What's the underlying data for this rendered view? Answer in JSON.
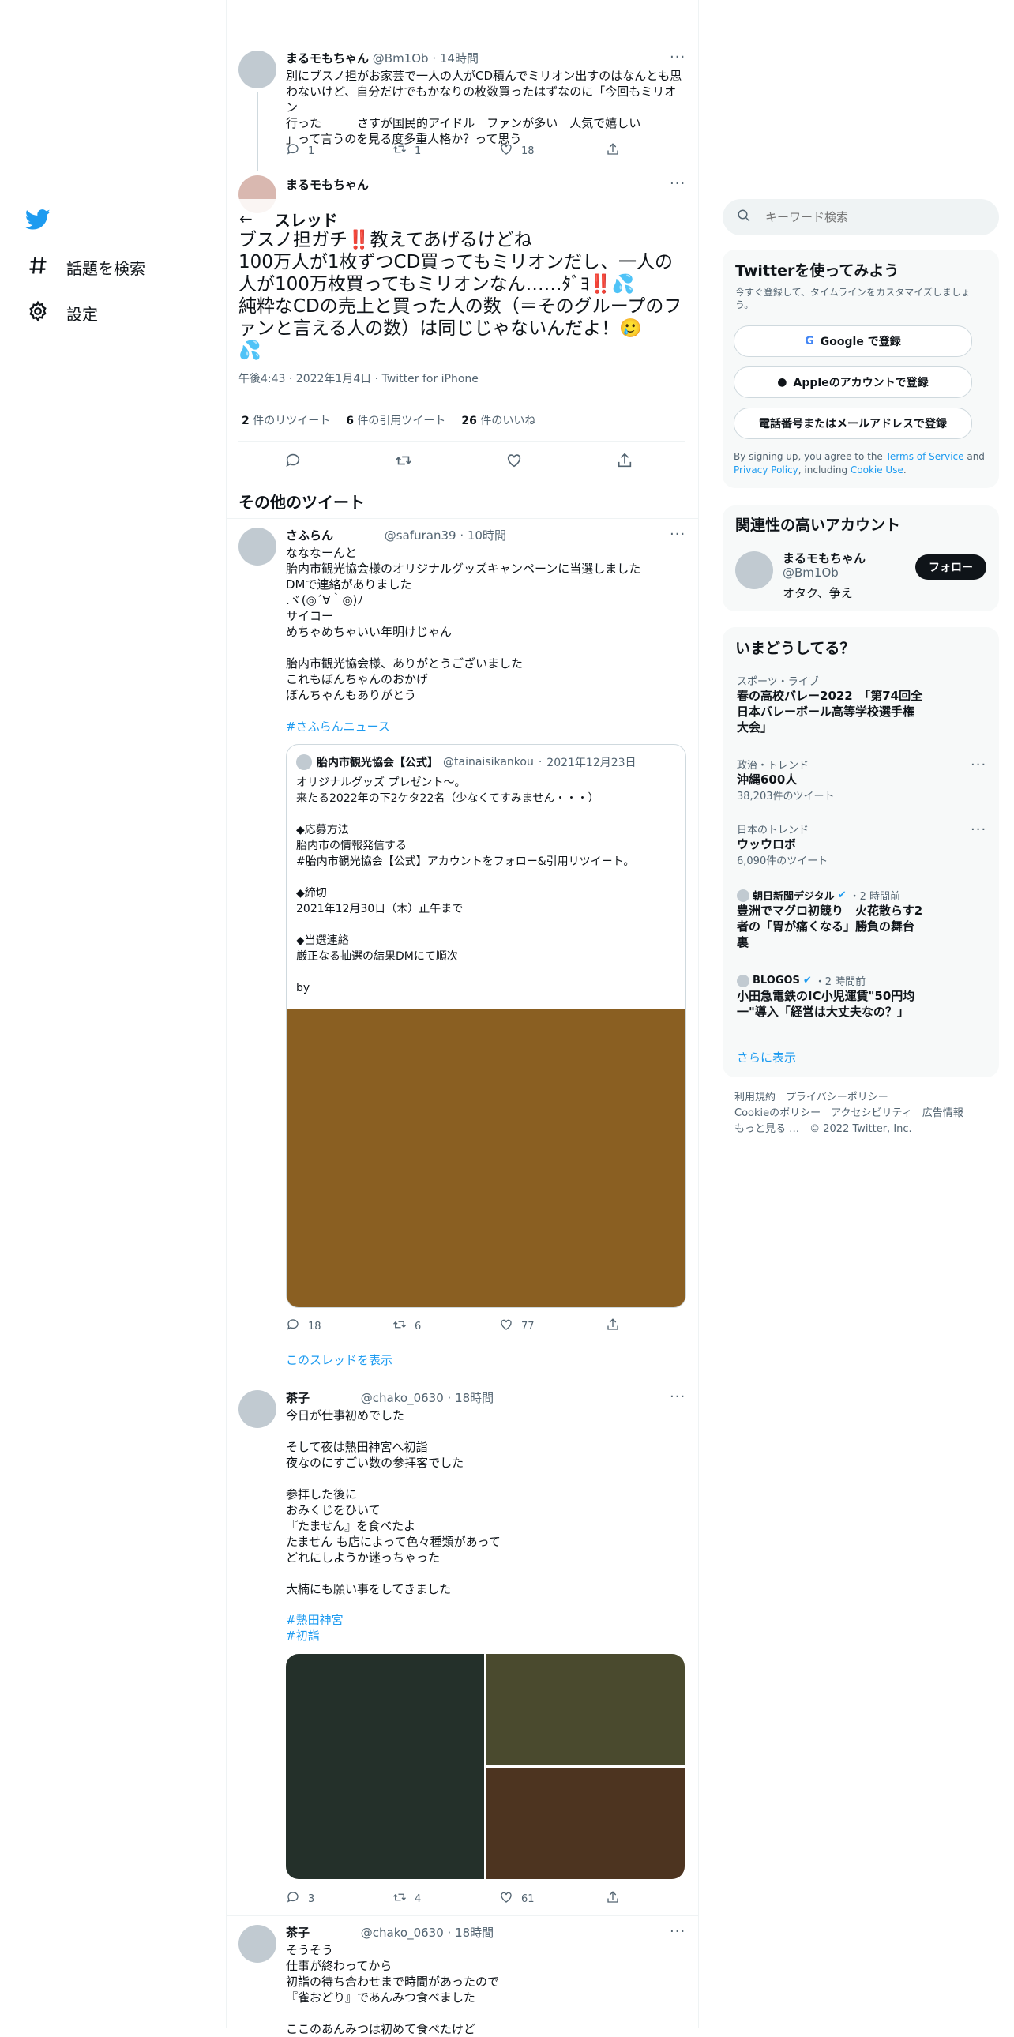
{
  "nav": {
    "items": [
      {
        "label": "話題を検索"
      },
      {
        "label": "設定"
      }
    ]
  },
  "header": {
    "title": "スレッド"
  },
  "thread_top": {
    "name": "まるモもちゃん",
    "handle": "@Bm1Ob",
    "time": "14時間",
    "text": "別にブスノ担がお家芸で一人の人がCD積んでミリオン出すのはなんとも思\nわないけど、自分だけでもかなりの枚数買ったはずなのに「今回もミリオン\n行った　　　さすが国民的アイドル　ファンが多い　人気で嬉しい\n」って言うのを見る度多重人格か？って思う",
    "replies": "1",
    "retweets": "1",
    "likes": "18"
  },
  "main_tweet": {
    "name": "まるモもちゃん",
    "text": "ブスノ担ガチ‼️教えてあげるけどね\n100万人が1枚ずつCD買ってもミリオンだし、一人の人が100万枚買ってもミリオンなん……ﾀﾞﾖ‼️💦\n純粋なCDの売上と買った人の数（＝そのグループのファンと言える人の数）は同じじゃないんだよ！🥲\n💦",
    "meta": "午後4:43 · 2022年1月4日 · Twitter for iPhone",
    "retweet_count": "2",
    "retweet_label": "件のリツイート",
    "quote_count": "6",
    "quote_label": "件の引用ツイート",
    "like_count": "26",
    "like_label": "件のいいね"
  },
  "more_tweets_heading": "その他のツイート",
  "tweet1": {
    "name": "さふらん",
    "handle": "@safuran39",
    "time": "10時間",
    "text": "なななーんと\n胎内市観光協会様のオリジナルグッズキャンペーンに当選しました\nDMで連絡がありました\n.ヾ(◎´∀｀◎)ﾉ\nサイコー\nめちゃめちゃいい年明けじゃん\n\n胎内市観光協会様、ありがとうございました\nこれもぼんちゃんのおかげ\nぼんちゃんもありがとう",
    "hashtag": "#さふらんニュース",
    "quote": {
      "name": "胎内市観光協会【公式】",
      "handle": "@tainaisikankou",
      "time": "2021年12月23日",
      "text": "オリジナルグッズ プレゼント〜。\n来たる2022年の下2ケタ22名（少なくてすみません・・・）\n\n◆応募方法\n胎内市の情報発信する\n#胎内市観光協会【公式】アカウントをフォロー&引用リツイート。\n\n◆締切\n2021年12月30日（木）正午まで\n\n◆当選連絡\n厳正なる抽選の結果DMにて順次\n\nby"
    },
    "replies": "18",
    "retweets": "6",
    "likes": "77",
    "show_thread": "このスレッドを表示"
  },
  "tweet2": {
    "name": "茶子",
    "handle": "@chako_0630",
    "time": "18時間",
    "text": "今日が仕事初めでした\n\nそして夜は熱田神宮へ初詣\n夜なのにすごい数の参拝客でした\n\n参拝した後に\nおみくじをひいて\n『たません』を食べたよ\nたません も店によって色々種類があって\nどれにしようか迷っちゃった\n\n大楠にも願い事をしてきました",
    "hashtag1": "#熱田神宮",
    "hashtag2": "#初詣",
    "replies": "3",
    "retweets": "4",
    "likes": "61"
  },
  "tweet3": {
    "name": "茶子",
    "handle": "@chako_0630",
    "time": "18時間",
    "text": "そうそう\n仕事が終わってから\n初詣の待ち合わせまで時間があったので\n『雀おどり』であんみつ食べました\n\nここのあんみつは初めて食べたけど"
  },
  "search": {
    "placeholder": "キーワード検索"
  },
  "signup": {
    "title": "Twitterを使ってみよう",
    "subtitle": "今すぐ登録して、タイムラインをカスタマイズしましょう。",
    "google": "Google で登録",
    "apple": "Appleのアカウントで登録",
    "phone": "電話番号またはメールアドレスで登録",
    "terms_pre": "By signing up, you agree to the ",
    "terms_link": "Terms of Service",
    "terms_and": " and ",
    "privacy_link": "Privacy Policy",
    "terms_including": ", including ",
    "cookie_link": "Cookie Use",
    "terms_end": "."
  },
  "relevant": {
    "title": "関連性の高いアカウント",
    "name": "まるモもちゃん",
    "handle": "@Bm1Ob",
    "bio": "オタク、争え",
    "follow": "フォロー"
  },
  "trends": {
    "title": "いまどうしてる？",
    "items": [
      {
        "cat": "スポーツ・ライブ",
        "title": "春の高校バレー2022　「第74回全\n日本バレーボール高等学校選手権\n大会」",
        "count": ""
      },
      {
        "cat": "政治・トレンド",
        "title": "沖縄600人",
        "count": "38,203件のツイート"
      },
      {
        "cat": "日本のトレンド",
        "title": "ウッウロボ",
        "count": "6,090件のツイート"
      },
      {
        "cat": "朝日新聞デジタル",
        "time": "・2 時間前",
        "title": "豊洲でマグロ初競り　火花散らす2\n者の「胃が痛くなる」勝負の舞台\n裏",
        "count": ""
      },
      {
        "cat": "BLOGOS",
        "time": "・2 時間前",
        "title": "小田急電鉄のIC小児運賃\"50円均\n一\"導入「経営は大丈夫なの？」",
        "count": ""
      }
    ],
    "show_more": "さらに表示"
  },
  "footer": {
    "line1": "利用規約　プライバシーポリシー",
    "line2": "Cookieのポリシー　アクセシビリティ　広告情報",
    "line3": "もっと見る …　© 2022 Twitter, Inc."
  },
  "colors": {
    "accent": "#1d9bf0",
    "quote_image": "#8a5f22",
    "photo_left": "#24302a",
    "photo_top_right": "#4a4a2e",
    "photo_bottom_right": "#4d3420"
  }
}
